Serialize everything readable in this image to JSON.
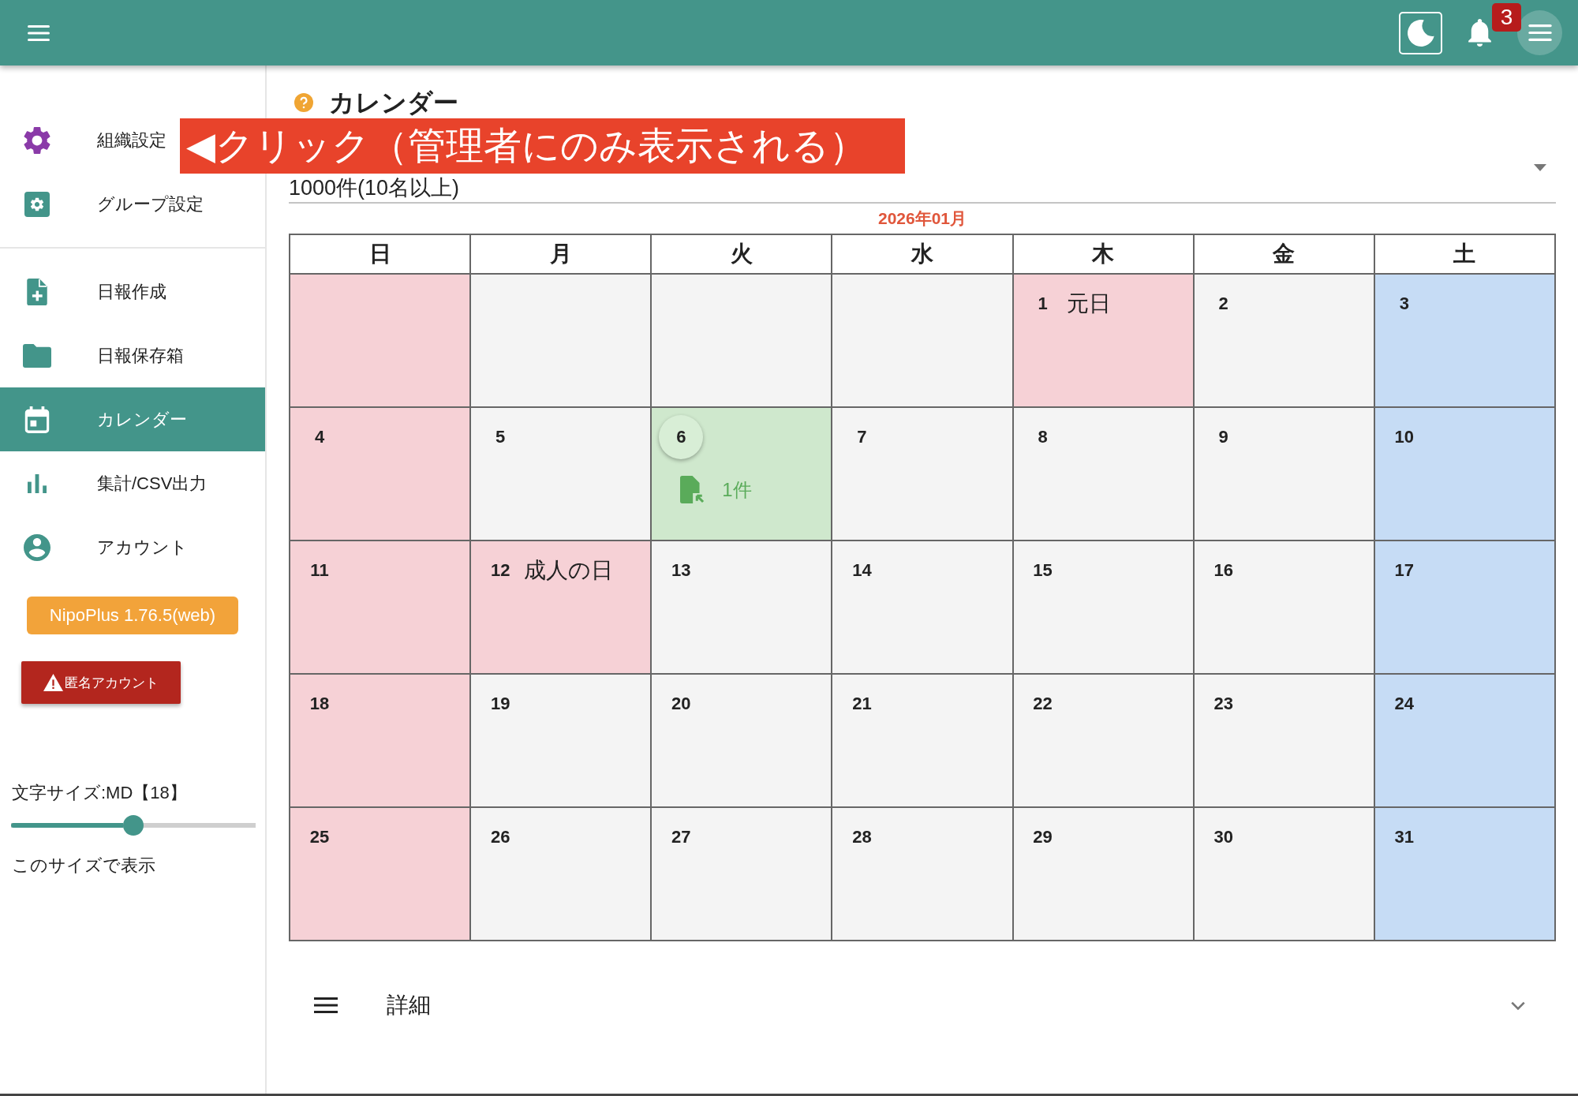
{
  "top_bar": {
    "notification_count": "3"
  },
  "sidebar": {
    "admin_items": [
      {
        "label": "組織設定",
        "selected": false
      },
      {
        "label": "グループ設定",
        "selected": false
      }
    ],
    "items": [
      {
        "label": "日報作成",
        "selected": false
      },
      {
        "label": "日報保存箱",
        "selected": false
      },
      {
        "label": "カレンダー",
        "selected": true
      },
      {
        "label": "集計/CSV出力",
        "selected": false
      },
      {
        "label": "アカウント",
        "selected": false
      }
    ],
    "version_button": "NipoPlus 1.76.5(web)",
    "anonymous_button": "匿名アカウント",
    "font_size": {
      "label": "文字サイズ:MD【18】",
      "level": 0.5,
      "apply": "このサイズで表示"
    }
  },
  "main": {
    "title": "カレンダー",
    "plan_select": {
      "value": "1000件(10名以上)"
    },
    "calendar": {
      "month": "2026年01月",
      "weekdays": [
        "日",
        "月",
        "火",
        "水",
        "木",
        "金",
        "土"
      ],
      "weeks": [
        [
          {
            "kind": "sunday"
          },
          {
            "kind": "weekday"
          },
          {
            "kind": "weekday"
          },
          {
            "kind": "weekday"
          },
          {
            "kind": "holiday",
            "day": "1",
            "holiday": "元日"
          },
          {
            "kind": "weekday",
            "day": "2"
          },
          {
            "kind": "saturday",
            "day": "3"
          }
        ],
        [
          {
            "kind": "sunday",
            "day": "4"
          },
          {
            "kind": "weekday",
            "day": "5"
          },
          {
            "kind": "today",
            "day": "6",
            "reports": "1件"
          },
          {
            "kind": "weekday",
            "day": "7"
          },
          {
            "kind": "weekday",
            "day": "8"
          },
          {
            "kind": "weekday",
            "day": "9"
          },
          {
            "kind": "saturday",
            "day": "10"
          }
        ],
        [
          {
            "kind": "sunday",
            "day": "11"
          },
          {
            "kind": "holiday",
            "day": "12",
            "holiday": "成人の日"
          },
          {
            "kind": "weekday",
            "day": "13"
          },
          {
            "kind": "weekday",
            "day": "14"
          },
          {
            "kind": "weekday",
            "day": "15"
          },
          {
            "kind": "weekday",
            "day": "16"
          },
          {
            "kind": "saturday",
            "day": "17"
          }
        ],
        [
          {
            "kind": "sunday",
            "day": "18"
          },
          {
            "kind": "weekday",
            "day": "19"
          },
          {
            "kind": "weekday",
            "day": "20"
          },
          {
            "kind": "weekday",
            "day": "21"
          },
          {
            "kind": "weekday",
            "day": "22"
          },
          {
            "kind": "weekday",
            "day": "23"
          },
          {
            "kind": "saturday",
            "day": "24"
          }
        ],
        [
          {
            "kind": "sunday",
            "day": "25"
          },
          {
            "kind": "weekday",
            "day": "26"
          },
          {
            "kind": "weekday",
            "day": "27"
          },
          {
            "kind": "weekday",
            "day": "28"
          },
          {
            "kind": "weekday",
            "day": "29"
          },
          {
            "kind": "weekday",
            "day": "30"
          },
          {
            "kind": "saturday",
            "day": "31"
          }
        ]
      ]
    }
  },
  "details": {
    "label": "詳細",
    "expanded": false
  },
  "overlay": {
    "text": "◀クリック（管理者にのみ表示される）"
  }
}
